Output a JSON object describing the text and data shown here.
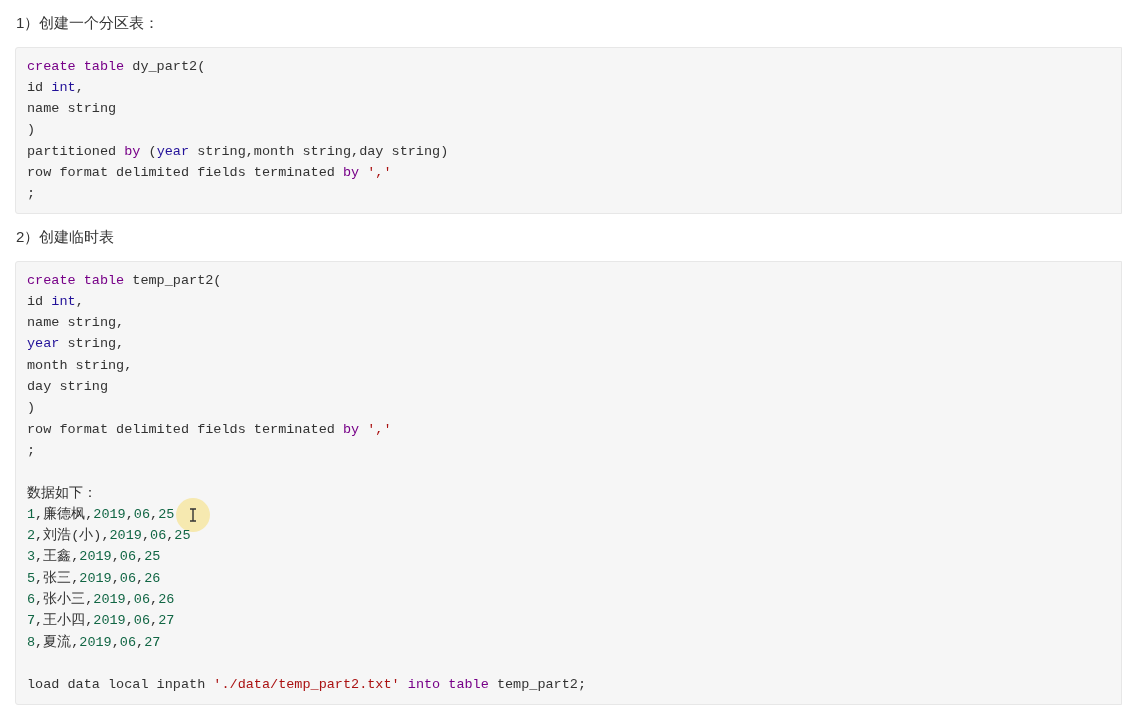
{
  "sections": [
    {
      "heading": "1）创建一个分区表：",
      "code_lines": [
        {
          "kind": "code",
          "tokens": [
            {
              "t": "create table",
              "kind": "keyword"
            },
            {
              "t": " dy_part2(",
              "kind": "plain"
            }
          ]
        },
        {
          "kind": "code",
          "tokens": [
            {
              "t": "id ",
              "kind": "plain"
            },
            {
              "t": "int",
              "kind": "type"
            },
            {
              "t": ",",
              "kind": "plain"
            }
          ]
        },
        {
          "kind": "code",
          "tokens": [
            {
              "t": "name string",
              "kind": "plain"
            }
          ]
        },
        {
          "kind": "code",
          "tokens": [
            {
              "t": ")",
              "kind": "plain"
            }
          ]
        },
        {
          "kind": "code",
          "tokens": [
            {
              "t": "partitioned ",
              "kind": "plain"
            },
            {
              "t": "by",
              "kind": "keyword"
            },
            {
              "t": " (",
              "kind": "plain"
            },
            {
              "t": "year",
              "kind": "type"
            },
            {
              "t": " string,month string,day string)",
              "kind": "plain"
            }
          ]
        },
        {
          "kind": "code",
          "tokens": [
            {
              "t": "row format delimited fields terminated ",
              "kind": "plain"
            },
            {
              "t": "by",
              "kind": "keyword"
            },
            {
              "t": " ','",
              "kind": "string"
            }
          ]
        },
        {
          "kind": "code",
          "tokens": [
            {
              "t": ";",
              "kind": "plain"
            }
          ]
        }
      ]
    },
    {
      "heading": "2）创建临时表",
      "code_lines": [
        {
          "kind": "code",
          "tokens": [
            {
              "t": "create table",
              "kind": "keyword"
            },
            {
              "t": " temp_part2(",
              "kind": "plain"
            }
          ]
        },
        {
          "kind": "code",
          "tokens": [
            {
              "t": "id ",
              "kind": "plain"
            },
            {
              "t": "int",
              "kind": "type"
            },
            {
              "t": ",",
              "kind": "plain"
            }
          ]
        },
        {
          "kind": "code",
          "tokens": [
            {
              "t": "name string,",
              "kind": "plain"
            }
          ]
        },
        {
          "kind": "code",
          "tokens": [
            {
              "t": "year",
              "kind": "type"
            },
            {
              "t": " string,",
              "kind": "plain"
            }
          ]
        },
        {
          "kind": "code",
          "tokens": [
            {
              "t": "month string,",
              "kind": "plain"
            }
          ]
        },
        {
          "kind": "code",
          "tokens": [
            {
              "t": "day string",
              "kind": "plain"
            }
          ]
        },
        {
          "kind": "code",
          "tokens": [
            {
              "t": ")",
              "kind": "plain"
            }
          ]
        },
        {
          "kind": "code",
          "tokens": [
            {
              "t": "row format delimited fields terminated ",
              "kind": "plain"
            },
            {
              "t": "by",
              "kind": "keyword"
            },
            {
              "t": " ','",
              "kind": "string"
            }
          ]
        },
        {
          "kind": "code",
          "tokens": [
            {
              "t": ";",
              "kind": "plain"
            }
          ]
        },
        {
          "kind": "blank"
        },
        {
          "kind": "code",
          "tokens": [
            {
              "t": "数据如下：",
              "kind": "plain"
            }
          ]
        },
        {
          "kind": "code",
          "cursor": true,
          "tokens": [
            {
              "t": "1",
              "kind": "number"
            },
            {
              "t": ",廉德枫,",
              "kind": "plain"
            },
            {
              "t": "2019",
              "kind": "number"
            },
            {
              "t": ",",
              "kind": "plain"
            },
            {
              "t": "06",
              "kind": "number"
            },
            {
              "t": ",",
              "kind": "plain"
            },
            {
              "t": "25",
              "kind": "number"
            }
          ]
        },
        {
          "kind": "code",
          "tokens": [
            {
              "t": "2",
              "kind": "number"
            },
            {
              "t": ",刘浩(小),",
              "kind": "plain"
            },
            {
              "t": "2019",
              "kind": "number"
            },
            {
              "t": ",",
              "kind": "plain"
            },
            {
              "t": "06",
              "kind": "number"
            },
            {
              "t": ",",
              "kind": "plain"
            },
            {
              "t": "25",
              "kind": "number"
            }
          ]
        },
        {
          "kind": "code",
          "tokens": [
            {
              "t": "3",
              "kind": "number"
            },
            {
              "t": ",王鑫,",
              "kind": "plain"
            },
            {
              "t": "2019",
              "kind": "number"
            },
            {
              "t": ",",
              "kind": "plain"
            },
            {
              "t": "06",
              "kind": "number"
            },
            {
              "t": ",",
              "kind": "plain"
            },
            {
              "t": "25",
              "kind": "number"
            }
          ]
        },
        {
          "kind": "code",
          "tokens": [
            {
              "t": "5",
              "kind": "number"
            },
            {
              "t": ",张三,",
              "kind": "plain"
            },
            {
              "t": "2019",
              "kind": "number"
            },
            {
              "t": ",",
              "kind": "plain"
            },
            {
              "t": "06",
              "kind": "number"
            },
            {
              "t": ",",
              "kind": "plain"
            },
            {
              "t": "26",
              "kind": "number"
            }
          ]
        },
        {
          "kind": "code",
          "tokens": [
            {
              "t": "6",
              "kind": "number"
            },
            {
              "t": ",张小三,",
              "kind": "plain"
            },
            {
              "t": "2019",
              "kind": "number"
            },
            {
              "t": ",",
              "kind": "plain"
            },
            {
              "t": "06",
              "kind": "number"
            },
            {
              "t": ",",
              "kind": "plain"
            },
            {
              "t": "26",
              "kind": "number"
            }
          ]
        },
        {
          "kind": "code",
          "tokens": [
            {
              "t": "7",
              "kind": "number"
            },
            {
              "t": ",王小四,",
              "kind": "plain"
            },
            {
              "t": "2019",
              "kind": "number"
            },
            {
              "t": ",",
              "kind": "plain"
            },
            {
              "t": "06",
              "kind": "number"
            },
            {
              "t": ",",
              "kind": "plain"
            },
            {
              "t": "27",
              "kind": "number"
            }
          ]
        },
        {
          "kind": "code",
          "tokens": [
            {
              "t": "8",
              "kind": "number"
            },
            {
              "t": ",夏流,",
              "kind": "plain"
            },
            {
              "t": "2019",
              "kind": "number"
            },
            {
              "t": ",",
              "kind": "plain"
            },
            {
              "t": "06",
              "kind": "number"
            },
            {
              "t": ",",
              "kind": "plain"
            },
            {
              "t": "27",
              "kind": "number"
            }
          ]
        },
        {
          "kind": "blank"
        },
        {
          "kind": "code",
          "tokens": [
            {
              "t": "load data local inpath ",
              "kind": "plain"
            },
            {
              "t": "'./data/temp_part2.txt'",
              "kind": "string"
            },
            {
              "t": " into table",
              "kind": "keyword"
            },
            {
              "t": " temp_part2;",
              "kind": "plain"
            }
          ]
        }
      ]
    }
  ]
}
